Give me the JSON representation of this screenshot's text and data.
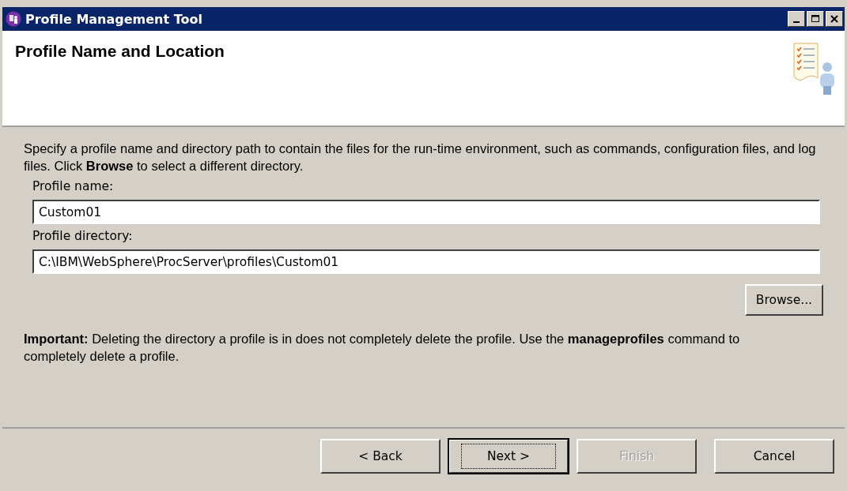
{
  "window": {
    "title": "Profile Management Tool"
  },
  "header": {
    "title": "Profile Name and Location"
  },
  "description": "Specify a profile name and directory path to contain the files for the run-time environment, such as commands, configuration files, and log files. Click **Browse** to select a different directory.",
  "fields": [
    {
      "label": "Profile name:",
      "value": "Custom01"
    },
    {
      "label": "Profile directory:",
      "value": "C:\\IBM\\WebSphere\\ProcServer\\profiles\\Custom01"
    }
  ],
  "browse_button": {
    "label": "Browse..."
  },
  "note": "**Important:** Deleting the directory a profile is in does not completely delete the profile. Use the **manageprofiles** command to completely delete a profile.",
  "buttons": [
    {
      "label": "< Back",
      "disabled": false,
      "default": false
    },
    {
      "label": "Next >",
      "disabled": false,
      "default": true
    },
    {
      "label": "Finish",
      "disabled": true,
      "default": false
    },
    {
      "label": "Cancel",
      "disabled": false,
      "default": false
    }
  ]
}
